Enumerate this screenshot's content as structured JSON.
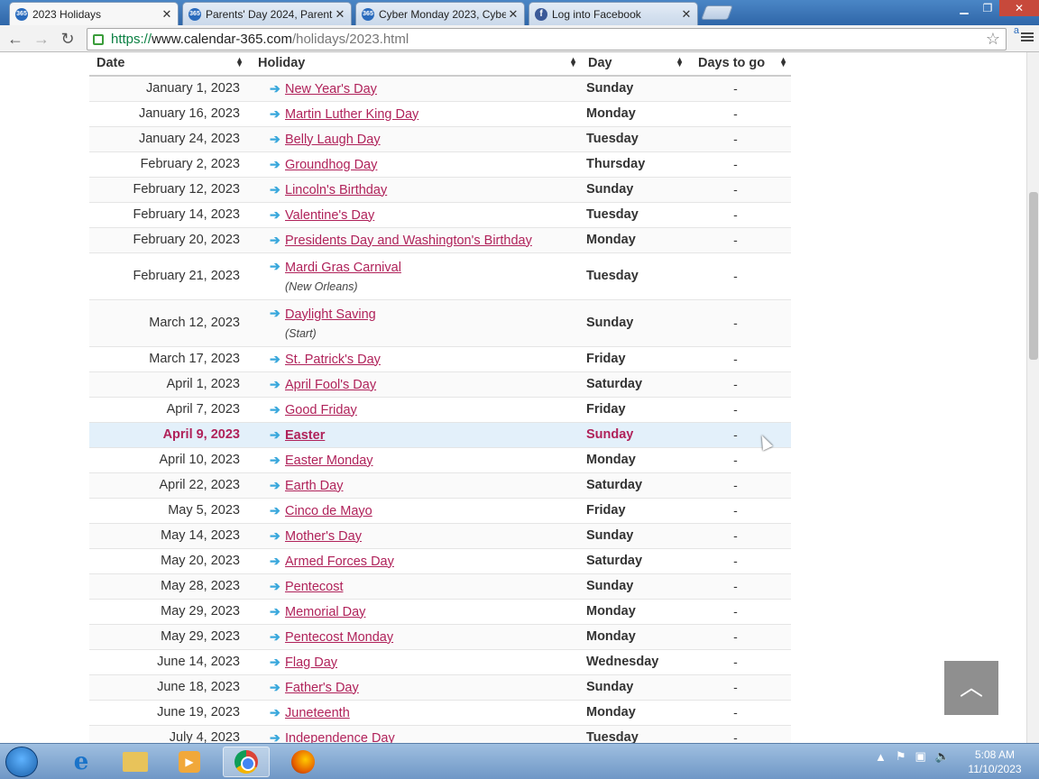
{
  "browser": {
    "tabs": [
      {
        "title": "2023 Holidays",
        "favicon": "365-icon",
        "active": true
      },
      {
        "title": "Parents' Day 2024, Parents",
        "favicon": "365-icon",
        "active": false
      },
      {
        "title": "Cyber Monday 2023, Cybe",
        "favicon": "365-icon",
        "active": false
      },
      {
        "title": "Log into Facebook",
        "favicon": "facebook-icon",
        "active": false
      }
    ],
    "url_scheme": "https://",
    "url_host": "www.calendar-365.com",
    "url_path": "/holidays/2023.html",
    "favicon_text": "365"
  },
  "table": {
    "headers": {
      "date": "Date",
      "holiday": "Holiday",
      "day": "Day",
      "days_to_go": "Days to go"
    },
    "rows": [
      {
        "date": "January 1, 2023",
        "holiday": "New Year's Day",
        "note": "",
        "day": "Sunday",
        "togo": "-"
      },
      {
        "date": "January 16, 2023",
        "holiday": "Martin Luther King Day",
        "note": "",
        "day": "Monday",
        "togo": "-"
      },
      {
        "date": "January 24, 2023",
        "holiday": "Belly Laugh Day",
        "note": "",
        "day": "Tuesday",
        "togo": "-"
      },
      {
        "date": "February 2, 2023",
        "holiday": "Groundhog Day",
        "note": "",
        "day": "Thursday",
        "togo": "-"
      },
      {
        "date": "February 12, 2023",
        "holiday": "Lincoln's Birthday",
        "note": "",
        "day": "Sunday",
        "togo": "-"
      },
      {
        "date": "February 14, 2023",
        "holiday": "Valentine's Day",
        "note": "",
        "day": "Tuesday",
        "togo": "-"
      },
      {
        "date": "February 20, 2023",
        "holiday": "Presidents Day and Washington's Birthday",
        "note": "",
        "day": "Monday",
        "togo": "-"
      },
      {
        "date": "February 21, 2023",
        "holiday": "Mardi Gras Carnival ",
        "note": "(New Orleans)",
        "day": "Tuesday",
        "togo": "-"
      },
      {
        "date": "March 12, 2023",
        "holiday": "Daylight Saving ",
        "note": "(Start)",
        "day": "Sunday",
        "togo": "-"
      },
      {
        "date": "March 17, 2023",
        "holiday": "St. Patrick's Day",
        "note": "",
        "day": "Friday",
        "togo": "-"
      },
      {
        "date": "April 1, 2023",
        "holiday": "April Fool's Day",
        "note": "",
        "day": "Saturday",
        "togo": "-"
      },
      {
        "date": "April 7, 2023",
        "holiday": "Good Friday",
        "note": "",
        "day": "Friday",
        "togo": "-"
      },
      {
        "date": "April 9, 2023",
        "holiday": "Easter",
        "note": "",
        "day": "Sunday",
        "togo": "-",
        "highlight": true
      },
      {
        "date": "April 10, 2023",
        "holiday": "Easter Monday",
        "note": "",
        "day": "Monday",
        "togo": "-"
      },
      {
        "date": "April 22, 2023",
        "holiday": "Earth Day",
        "note": "",
        "day": "Saturday",
        "togo": "-"
      },
      {
        "date": "May 5, 2023",
        "holiday": "Cinco de Mayo",
        "note": "",
        "day": "Friday",
        "togo": "-"
      },
      {
        "date": "May 14, 2023",
        "holiday": "Mother's Day",
        "note": "",
        "day": "Sunday",
        "togo": "-"
      },
      {
        "date": "May 20, 2023",
        "holiday": "Armed Forces Day",
        "note": "",
        "day": "Saturday",
        "togo": "-"
      },
      {
        "date": "May 28, 2023",
        "holiday": "Pentecost",
        "note": "",
        "day": "Sunday",
        "togo": "-"
      },
      {
        "date": "May 29, 2023",
        "holiday": "Memorial Day",
        "note": "",
        "day": "Monday",
        "togo": "-"
      },
      {
        "date": "May 29, 2023",
        "holiday": "Pentecost Monday",
        "note": "",
        "day": "Monday",
        "togo": "-"
      },
      {
        "date": "June 14, 2023",
        "holiday": "Flag Day",
        "note": "",
        "day": "Wednesday",
        "togo": "-"
      },
      {
        "date": "June 18, 2023",
        "holiday": "Father's Day",
        "note": "",
        "day": "Sunday",
        "togo": "-"
      },
      {
        "date": "June 19, 2023",
        "holiday": "Juneteenth",
        "note": "",
        "day": "Monday",
        "togo": "-"
      },
      {
        "date": "July 4, 2023",
        "holiday": "Independence Day",
        "note": "",
        "day": "Tuesday",
        "togo": "-"
      }
    ]
  },
  "taskbar": {
    "time": "5:08 AM",
    "date": "11/10/2023"
  },
  "colors": {
    "link": "#b0225a",
    "highlight_row": "#e3f0fa",
    "arrow": "#3aa8dc"
  }
}
